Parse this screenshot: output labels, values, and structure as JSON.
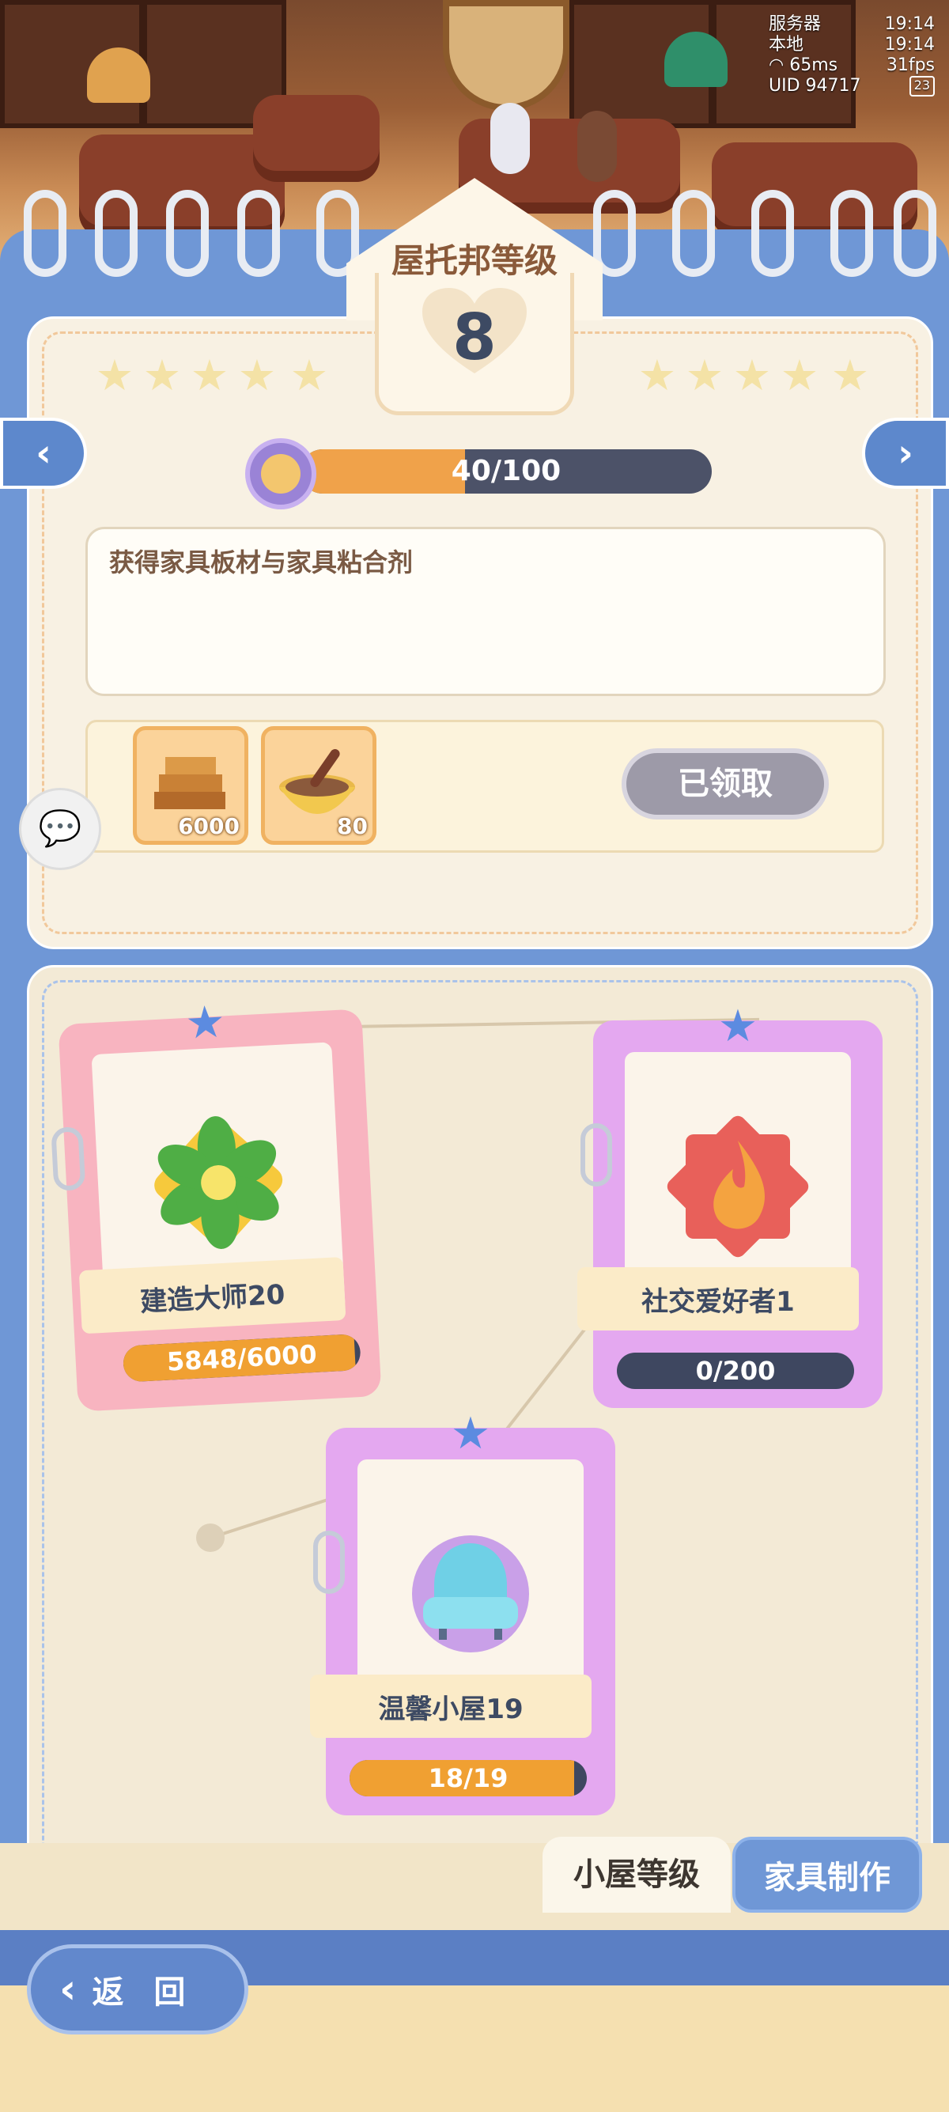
{
  "hud": {
    "server_label": "服务器",
    "server_time": "19:14",
    "local_label": "本地",
    "local_time": "19:14",
    "ping": "65ms",
    "fps": "31fps",
    "uid": "UID 94717",
    "battery": "23"
  },
  "level": {
    "title": "屋托邦等级",
    "number": "8",
    "progress_text": "40/100",
    "progress_fraction": 0.4,
    "description": "获得家具板材与家具粘合剂"
  },
  "rewards": [
    {
      "name": "wood-planks",
      "qty": "6000"
    },
    {
      "name": "furniture-glue",
      "qty": "80"
    }
  ],
  "claim_button": "已领取",
  "nav": {
    "prev": "‹",
    "next": "›"
  },
  "cards": [
    {
      "label": "建造大师20",
      "progress_text": "5848/6000",
      "progress_fraction": 0.975,
      "icon": "flower-icon"
    },
    {
      "label": "社交爱好者1",
      "progress_text": "0/200",
      "progress_fraction": 0.0,
      "icon": "flame-icon"
    },
    {
      "label": "温馨小屋19",
      "progress_text": "18/19",
      "progress_fraction": 0.947,
      "icon": "armchair-icon"
    }
  ],
  "tabs": {
    "room_level": "小屋等级",
    "furniture_making": "家具制作"
  },
  "back": {
    "label": "返 回"
  },
  "colors": {
    "accent_blue": "#6f97d6",
    "progress_orange": "#f0a24a",
    "card_pink": "#f8b4c0",
    "card_purple": "#e4a8f0"
  }
}
